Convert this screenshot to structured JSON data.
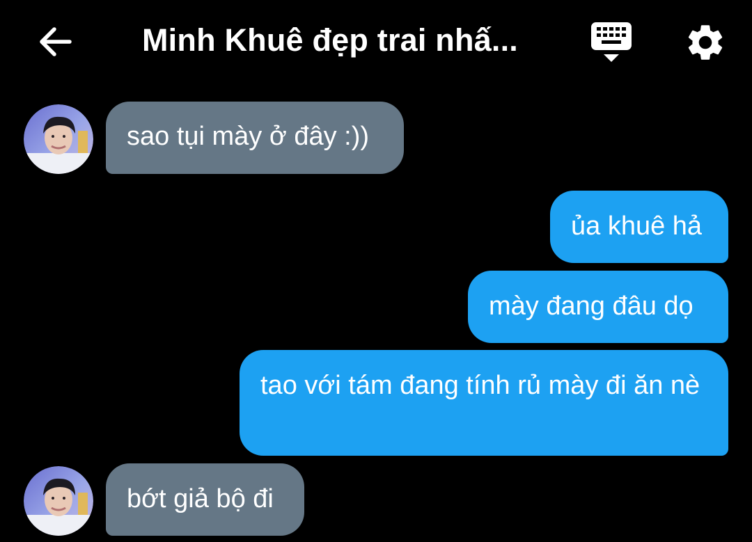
{
  "header": {
    "title": "Minh Khuê đẹp trai nhấ...",
    "back_icon": "arrow-left-icon",
    "keyboard_icon": "keyboard-icon",
    "settings_icon": "gear-icon"
  },
  "colors": {
    "background": "#000000",
    "incoming_bubble": "#657786",
    "outgoing_bubble": "#1da1f2",
    "text": "#ffffff"
  },
  "messages": [
    {
      "direction": "incoming",
      "text": "sao tụi mày ở đây :))"
    },
    {
      "direction": "outgoing",
      "text": "ủa khuê hả"
    },
    {
      "direction": "outgoing",
      "text": "mày đang đâu dọ"
    },
    {
      "direction": "outgoing",
      "text": "tao với tám đang tính rủ mày đi ăn nè"
    },
    {
      "direction": "incoming",
      "text": "bớt giả bộ đi"
    }
  ]
}
